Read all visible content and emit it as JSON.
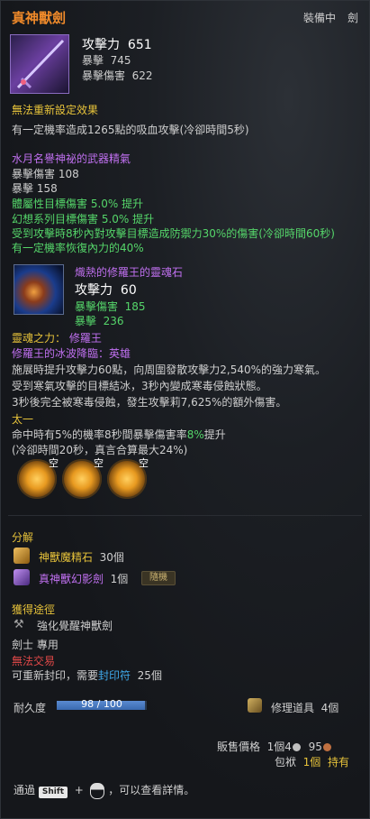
{
  "header": {
    "title": "真神獸劍",
    "status": "裝備中",
    "slot": "劍"
  },
  "stats": {
    "attack_label": "攻擊力",
    "attack_value": "651",
    "crit_label": "暴擊",
    "crit_value": "745",
    "critdmg_label": "暴擊傷害",
    "critdmg_value": "622"
  },
  "reset_note": "無法重新設定效果",
  "effect_line": "有一定機率造成1265點的吸血攻擊(冷卻時間5秒)",
  "essence": {
    "title": "水月名譽神祕的武器精氣",
    "critdmg": "暴擊傷害  108",
    "crit": "暴擊  158",
    "line1": "體屬性目標傷害  5.0%  提升",
    "line2": "幻想系列目標傷害  5.0%  提升",
    "line3": "受到攻擊時8秒內對攻擊目標造成防禦力30%的傷害(冷卻時間60秒)",
    "line4": "有一定機率恢復內力的40%"
  },
  "soul": {
    "name": "熾熱的修羅王的靈魂石",
    "attack_label": "攻擊力",
    "attack_value": "60",
    "critdmg_label": "暴擊傷害",
    "critdmg_value": "185",
    "crit_label": "暴擊",
    "crit_value": "236",
    "power_label": "靈魂之力：",
    "power_value": "修羅王",
    "skill_name": "修羅王的冰波降臨：英雄",
    "desc1": "施展時提升攻擊力60點，向周圍發散攻擊力2,540%的強力寒氣。",
    "desc2": "受到寒氣攻擊的目標結冰，3秒內變成寒毒侵蝕狀態。",
    "desc3": "3秒後完全被寒毒侵蝕，發生攻擊莉7,625%的額外傷害。"
  },
  "taiyi": {
    "title": "太一",
    "line1_a": "命中時有5%的機率8秒間暴擊傷害率",
    "line1_b": "8%",
    "line1_c": "提升",
    "line2": "(冷卻時間20秒，真言合算最大24%)"
  },
  "gems": [
    {
      "mark": "空"
    },
    {
      "mark": "空"
    },
    {
      "mark": "空"
    }
  ],
  "decompose": {
    "title": "分解",
    "item1_name": "神獸魔精石",
    "item1_count": "30個",
    "item2_name": "真神獸幻影劍",
    "item2_count": "1個",
    "item2_badge": "隨機"
  },
  "acquire": {
    "title": "獲得途徑",
    "source": "強化覺醒神獸劍",
    "restriction": "劍士  專用"
  },
  "trade": {
    "title": "無法交易",
    "reseal_a": "可重新封印，需要",
    "reseal_link": "封印符",
    "reseal_count": "25個"
  },
  "durability": {
    "label": "耐久度",
    "current": 98,
    "max": 100,
    "text": "98 / 100",
    "repair_label": "修理道具",
    "repair_count": "4個"
  },
  "price": {
    "label": "販售價格",
    "gold": "1個4",
    "silver": "95",
    "bag_label": "包袱",
    "bag_count": "1個",
    "bag_status": "持有"
  },
  "footer": {
    "prefix": "通過",
    "key": "Shift",
    "plus": "+",
    "suffix": "，可以查看詳情。"
  },
  "colors": {
    "orange": "#f08a2a",
    "yellow": "#e6c23a",
    "green": "#55d66a",
    "purple": "#c070f0",
    "blue": "#3fa8e8",
    "red": "#e04848"
  }
}
